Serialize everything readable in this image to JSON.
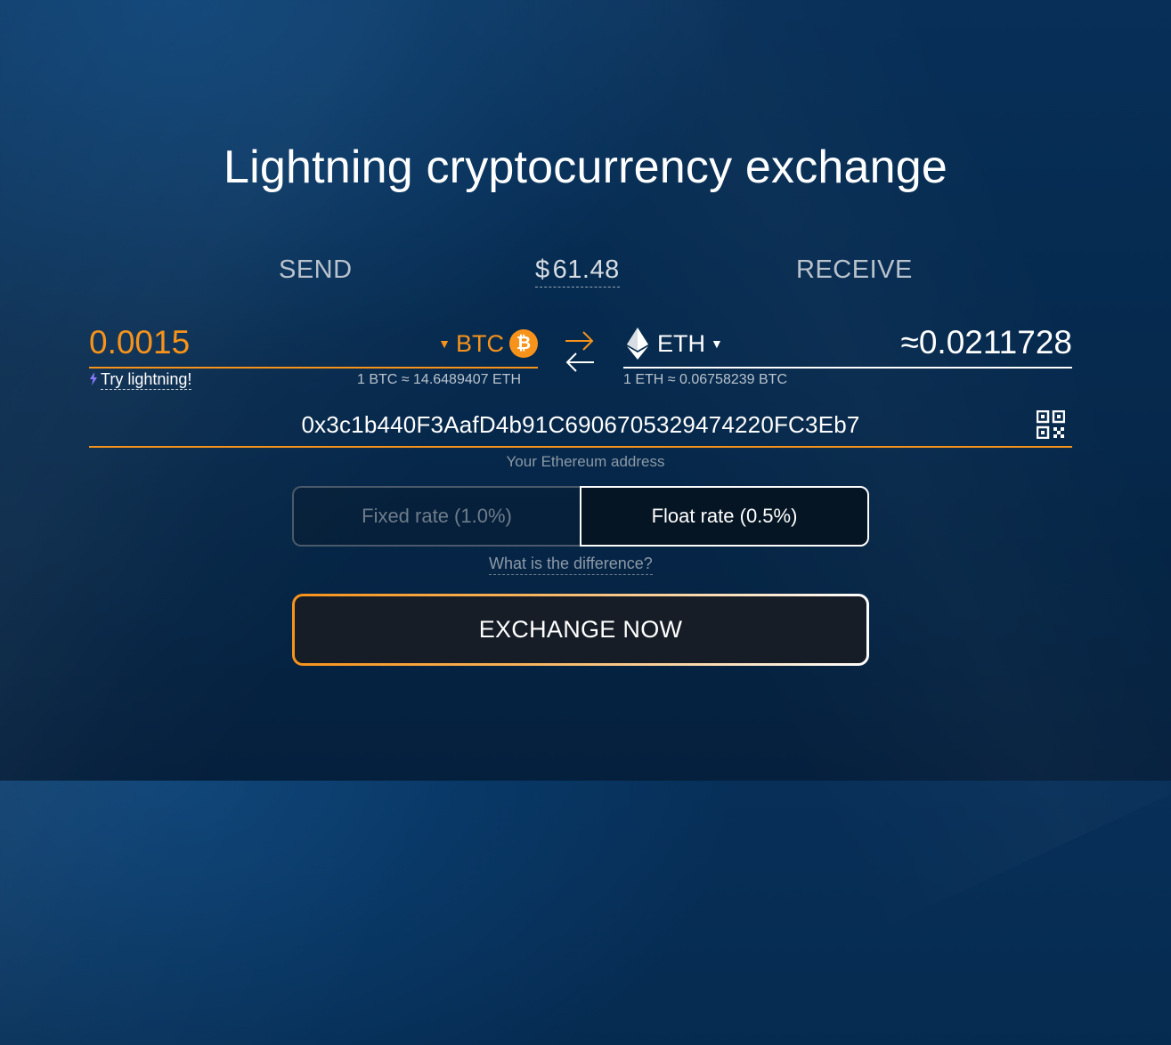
{
  "headline": "Lightning cryptocurrency exchange",
  "send": {
    "label": "SEND",
    "amount": "0.0015",
    "coin": "BTC",
    "coin_icon": "bitcoin-icon",
    "lightning_link": "Try lightning!",
    "rate": "1 BTC ≈ 14.6489407 ETH"
  },
  "usd": {
    "symbol": "$",
    "value": "61.48"
  },
  "receive": {
    "label": "RECEIVE",
    "coin": "ETH",
    "coin_icon": "ethereum-icon",
    "amount": "≈0.0211728",
    "rate": "1 ETH ≈ 0.06758239 BTC"
  },
  "address": {
    "value": "0x3c1b440F3AafD4b91C6906705329474220FC3Eb7",
    "caption": "Your Ethereum address"
  },
  "rate_type": {
    "fixed": "Fixed rate (1.0%)",
    "float": "Float rate (0.5%)",
    "selected": "float",
    "difference_link": "What is the difference?"
  },
  "exchange_button": "EXCHANGE NOW",
  "colors": {
    "accent": "#f7931a",
    "background": "#062a4e",
    "lightning": "#8a7cff"
  }
}
